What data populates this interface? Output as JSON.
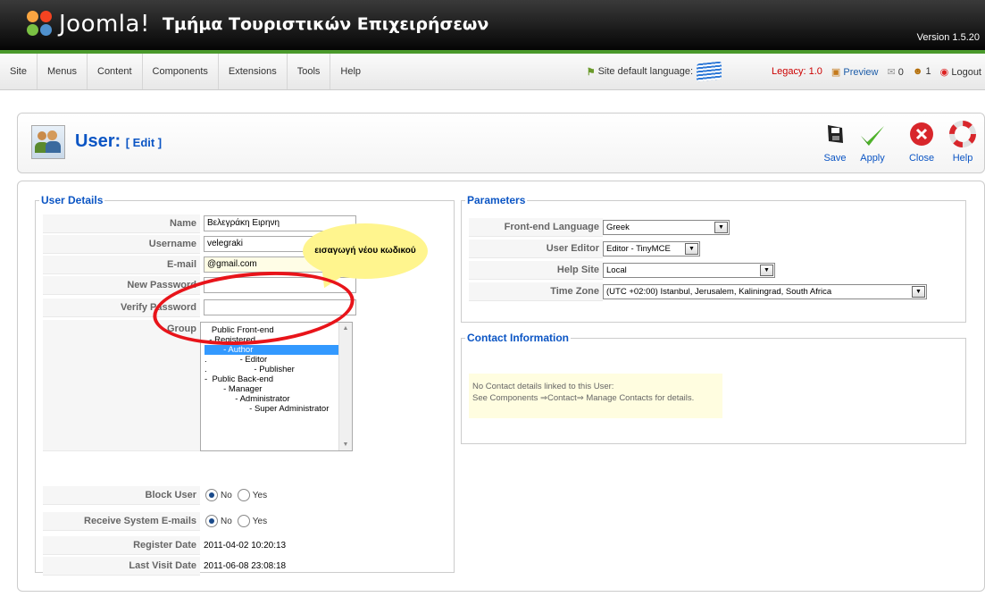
{
  "header": {
    "logo_text": "Joomla!",
    "site_title": "Τμήμα Τουριστικών Επιχειρήσεων",
    "version": "Version 1.5.20"
  },
  "menu": [
    "Site",
    "Menus",
    "Content",
    "Components",
    "Extensions",
    "Tools",
    "Help"
  ],
  "status": {
    "site_language_label": "Site default language:",
    "legacy": "Legacy: 1.0",
    "preview": "Preview",
    "messages_count": "0",
    "users_count": "1",
    "logout": "Logout"
  },
  "toolbar": {
    "title": "User:",
    "subtitle": "[ Edit ]",
    "save": "Save",
    "apply": "Apply",
    "close": "Close",
    "help": "Help"
  },
  "user_details": {
    "legend": "User Details",
    "name_label": "Name",
    "name_value": "Βελεγράκη Ειρηνη",
    "username_label": "Username",
    "username_value": "velegraki",
    "email_label": "E-mail",
    "email_value": "@gmail.com",
    "new_password_label": "New Password",
    "new_password_value": "",
    "verify_password_label": "Verify Password",
    "verify_password_value": "",
    "group_label": "Group",
    "groups": [
      "   Public Front-end",
      ". - Registered",
      "        - Author",
      ".              - Editor",
      ".                    - Publisher",
      "-  Public Back-end",
      "        - Manager",
      "             - Administrator",
      "                   - Super Administrator"
    ],
    "selected_group_index": 2,
    "block_user_label": "Block User",
    "receive_emails_label": "Receive System E-mails",
    "no": "No",
    "yes": "Yes",
    "register_date_label": "Register Date",
    "register_date": "2011-04-02 10:20:13",
    "last_visit_label": "Last Visit Date",
    "last_visit": "2011-06-08 23:08:18"
  },
  "parameters": {
    "legend": "Parameters",
    "frontend_language_label": "Front-end Language",
    "frontend_language": "Greek",
    "user_editor_label": "User Editor",
    "user_editor": "Editor - TinyMCE",
    "help_site_label": "Help Site",
    "help_site": "Local",
    "time_zone_label": "Time Zone",
    "time_zone": "(UTC +02:00) Istanbul, Jerusalem, Kaliningrad, South Africa"
  },
  "contact": {
    "legend": "Contact Information",
    "line1": "No Contact details linked to this User:",
    "line2": "See Components ⇒Contact⇒ Manage Contacts for details."
  },
  "annotation": {
    "bubble_text": "εισαγωγή νέου κωδικού"
  }
}
